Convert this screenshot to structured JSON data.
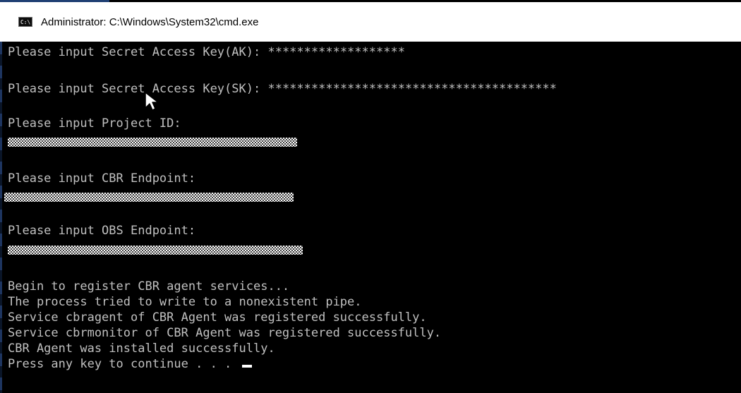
{
  "window": {
    "title": "Administrator: C:\\Windows\\System32\\cmd.exe",
    "icon": "cmd-icon",
    "icon_text": "C:\\"
  },
  "colors": {
    "console_bg": "#000000",
    "console_text": "#c0c0c0",
    "titlebar_bg": "#ffffff"
  },
  "console": {
    "prompts": {
      "ak_label": "Please input Secret Access Key(AK): ",
      "ak_value": "*******************",
      "sk_label": "Please input Secret Access Key(SK): ",
      "sk_value": "****************************************",
      "project_label": "Please input Project ID:",
      "cbr_label": "Please input CBR Endpoint:",
      "obs_label": "Please input OBS Endpoint:"
    },
    "output": [
      "Begin to register CBR agent services...",
      "The process tried to write to a nonexistent pipe.",
      "Service cbragent of CBR Agent was registered successfully.",
      "Service cbrmonitor of CBR Agent was registered successfully.",
      "CBR Agent was installed successfully."
    ],
    "final_prompt": "Press any key to continue . . . "
  }
}
